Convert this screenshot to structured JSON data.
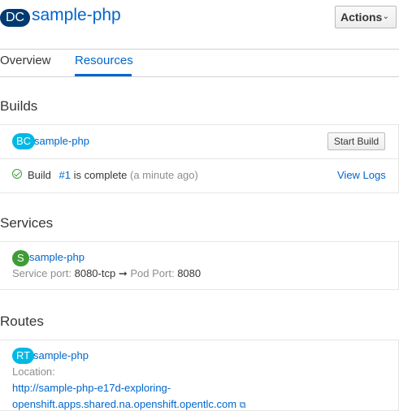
{
  "header": {
    "badge": "DC",
    "title": "sample-php",
    "actions_label": "Actions",
    "actions_chevron": "⌄"
  },
  "tabs": [
    {
      "label": "Overview",
      "active": false
    },
    {
      "label": "Resources",
      "active": true
    }
  ],
  "builds": {
    "heading": "Builds",
    "badge": "BC",
    "name": "sample-php",
    "start_build_label": "Start Build",
    "status": {
      "prefix": "Build",
      "number": "#1",
      "state": "is complete",
      "time": "(a minute ago)"
    },
    "view_logs_label": "View Logs"
  },
  "services": {
    "heading": "Services",
    "badge": "S",
    "name": "sample-php",
    "service_port_label": "Service port:",
    "service_port_value": "8080-tcp",
    "arrow": "➞",
    "pod_port_label": "Pod Port:",
    "pod_port_value": "8080"
  },
  "routes": {
    "heading": "Routes",
    "badge": "RT",
    "name": "sample-php",
    "location_label": "Location:",
    "url_line1": "http://sample-php-e17d-exploring-",
    "url_line2": "openshift.apps.shared.na.openshift.opentlc.com",
    "external_icon": "⧉"
  },
  "colors": {
    "link": "#0066cc",
    "dc_badge": "#003a70",
    "bc_badge": "#00b9e4",
    "service_badge": "#3f9c35",
    "success": "#3f9c35"
  }
}
